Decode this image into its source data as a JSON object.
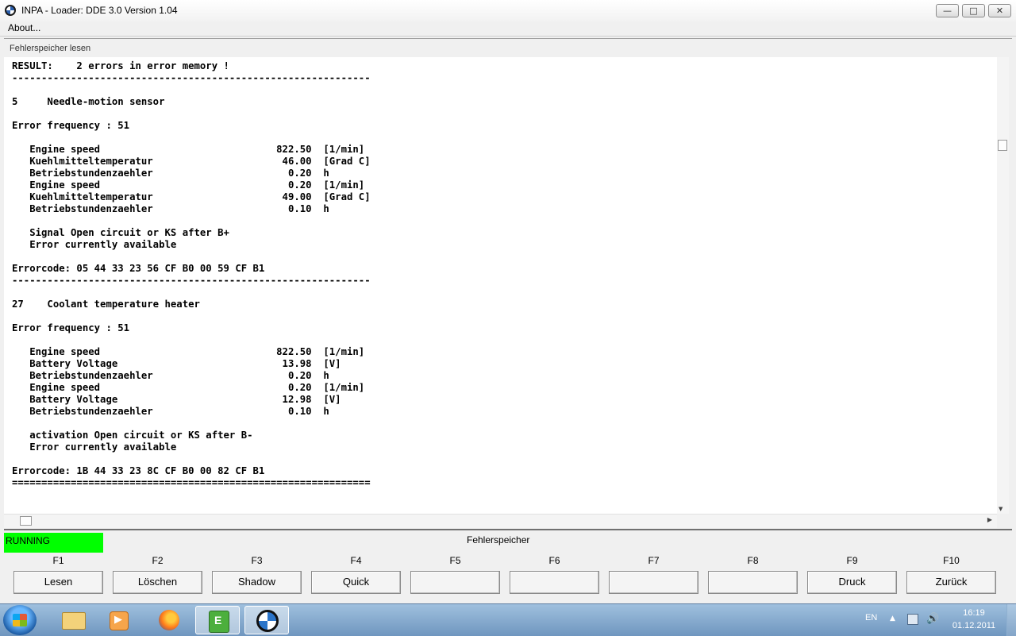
{
  "window": {
    "title": "INPA - Loader:  DDE 3.0 Version 1.04",
    "minimize_glyph": "—",
    "maximize_glyph": "□",
    "close_glyph": "✕"
  },
  "menu": {
    "about_label": "About..."
  },
  "section": {
    "title": "Fehlerspeicher lesen"
  },
  "output": {
    "lines": [
      "RESULT:    2 errors in error memory !",
      "-------------------------------------------------------------",
      "",
      "5     Needle-motion sensor",
      "",
      "Error frequency : 51",
      "",
      "   Engine speed                              822.50  [1/min]",
      "   Kuehlmitteltemperatur                      46.00  [Grad C]",
      "   Betriebstundenzaehler                       0.20  h",
      "   Engine speed                                0.20  [1/min]",
      "   Kuehlmitteltemperatur                      49.00  [Grad C]",
      "   Betriebstundenzaehler                       0.10  h",
      "",
      "   Signal Open circuit or KS after B+",
      "   Error currently available",
      "",
      "Errorcode: 05 44 33 23 56 CF B0 00 59 CF B1",
      "-------------------------------------------------------------",
      "",
      "27    Coolant temperature heater",
      "",
      "Error frequency : 51",
      "",
      "   Engine speed                              822.50  [1/min]",
      "   Battery Voltage                            13.98  [V]",
      "   Betriebstundenzaehler                       0.20  h",
      "   Engine speed                                0.20  [1/min]",
      "   Battery Voltage                            12.98  [V]",
      "   Betriebstundenzaehler                       0.10  h",
      "",
      "   activation Open circuit or KS after B-",
      "   Error currently available",
      "",
      "Errorcode: 1B 44 33 23 8C CF B0 00 82 CF B1",
      "============================================================="
    ]
  },
  "status": {
    "state_label": "RUNNING",
    "state_color": "#00ff00",
    "screen_title": "Fehlerspeicher"
  },
  "fkeys": [
    {
      "key": "F1",
      "label": "Lesen"
    },
    {
      "key": "F2",
      "label": "Löschen"
    },
    {
      "key": "F3",
      "label": "Shadow"
    },
    {
      "key": "F4",
      "label": "Quick"
    },
    {
      "key": "F5",
      "label": ""
    },
    {
      "key": "F6",
      "label": ""
    },
    {
      "key": "F7",
      "label": ""
    },
    {
      "key": "F8",
      "label": ""
    },
    {
      "key": "F9",
      "label": "Druck"
    },
    {
      "key": "F10",
      "label": "Zurück"
    }
  ],
  "taskbar": {
    "items": [
      "start-icon",
      "explorer-icon",
      "media-player-icon",
      "firefox-icon",
      "ediabas-icon",
      "inpa-icon"
    ],
    "language": "EN",
    "time": "16:19",
    "date": "01.12.2011"
  }
}
